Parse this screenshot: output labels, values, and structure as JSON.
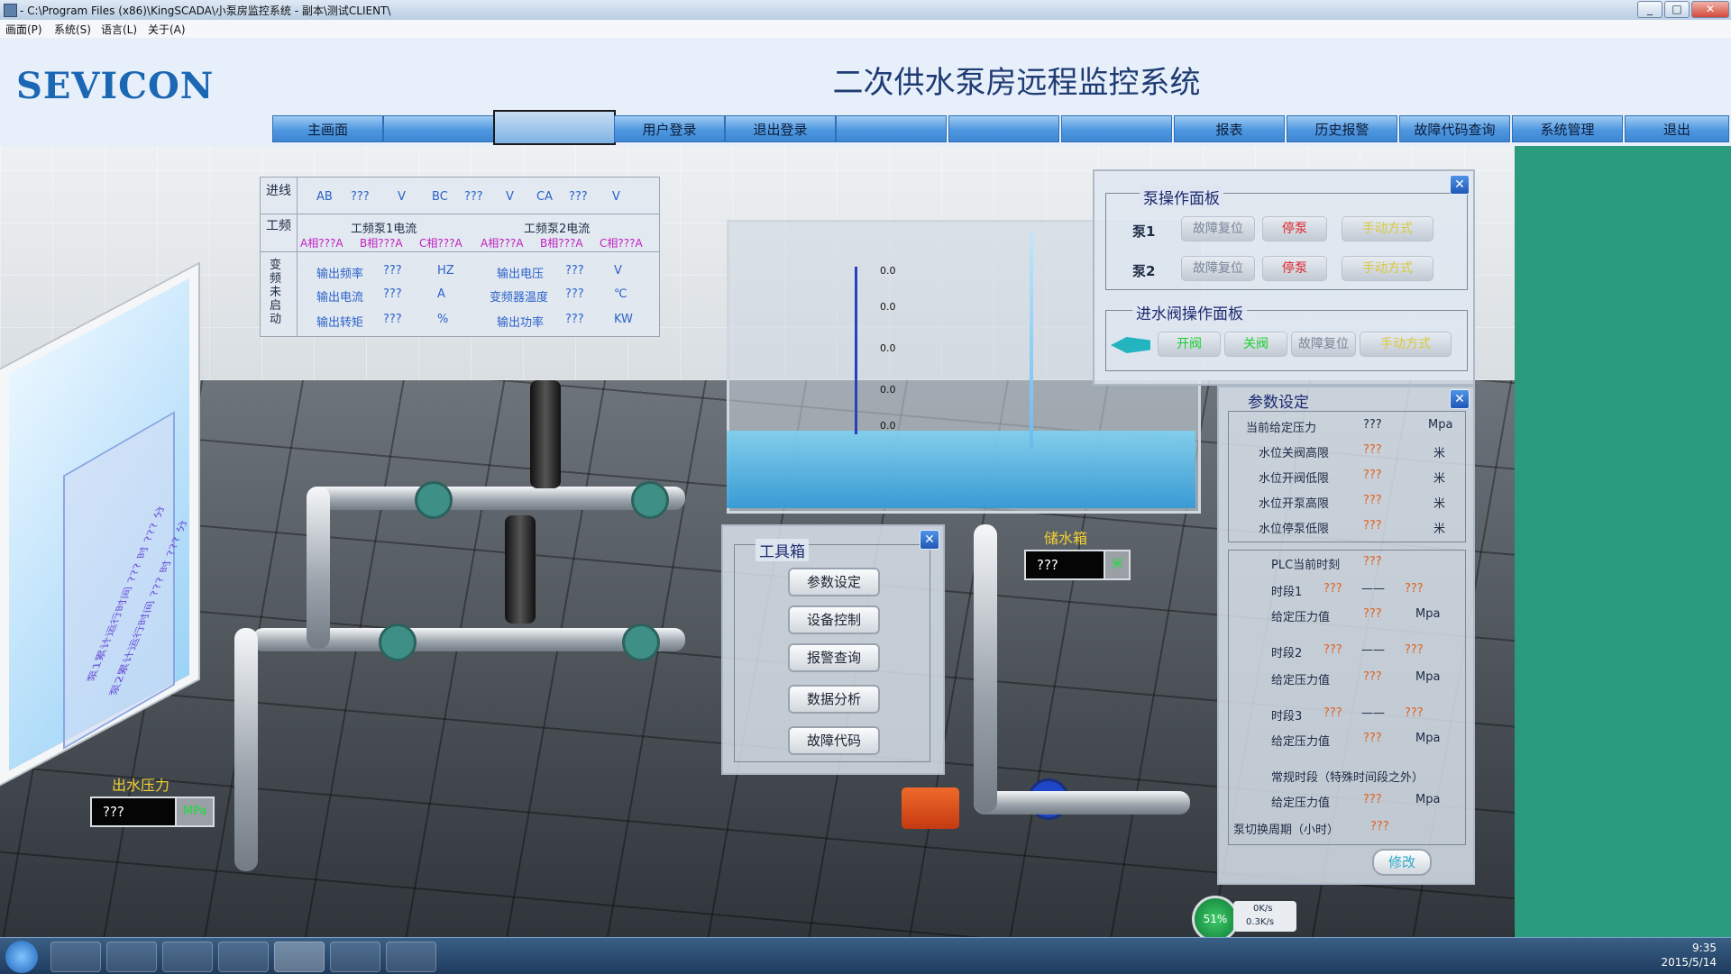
{
  "window": {
    "title": "- C:\\Program Files (x86)\\KingSCADA\\小泵房监控系统 - 副本\\测试CLIENT\\"
  },
  "menus": [
    "画面(P)",
    "系统(S)",
    "语言(L)",
    "关于(A)"
  ],
  "header": {
    "logo": "SEVICON",
    "title": "二次供水泵房远程监控系统"
  },
  "nav": [
    "主画面",
    "",
    "",
    "用户登录",
    "退出登录",
    "",
    "",
    "",
    "报表",
    "历史报警",
    "故障代码查询",
    "系统管理",
    "退出"
  ],
  "info_table": {
    "row1_label": "进线",
    "voltages": [
      {
        "pair": "AB",
        "value": "???",
        "unit": "V"
      },
      {
        "pair": "BC",
        "value": "???",
        "unit": "V"
      },
      {
        "pair": "CA",
        "value": "???",
        "unit": "V"
      }
    ],
    "row2_label": "工频",
    "pump1_current_title": "工频泵1电流",
    "pump2_current_title": "工频泵2电流",
    "phase_currents": [
      "A相???A",
      "B相???A",
      "C相???A",
      "A相???A",
      "B相???A",
      "C相???A"
    ],
    "row3_label": "变频未启动",
    "vfd": [
      [
        {
          "label": "输出频率",
          "value": "???",
          "unit": "HZ"
        },
        {
          "label": "输出电压",
          "value": "???",
          "unit": "V"
        }
      ],
      [
        {
          "label": "输出电流",
          "value": "???",
          "unit": "A"
        },
        {
          "label": "变频器温度",
          "value": "???",
          "unit": "℃"
        }
      ],
      [
        {
          "label": "输出转矩",
          "value": "???",
          "unit": "%"
        },
        {
          "label": "输出功率",
          "value": "???",
          "unit": "KW"
        }
      ]
    ]
  },
  "pump_panel": {
    "title": "泵操作面板",
    "pumps": [
      {
        "name": "泵1",
        "reset": "故障复位",
        "stop": "停泵",
        "mode": "手动方式"
      },
      {
        "name": "泵2",
        "reset": "故障复位",
        "stop": "停泵",
        "mode": "手动方式"
      }
    ],
    "valve_title": "进水阀操作面板",
    "valve_buttons": {
      "open": "开阀",
      "close": "关阀",
      "reset": "故障复位",
      "mode": "手动方式"
    }
  },
  "param_panel": {
    "title": "参数设定",
    "current_pressure": {
      "label": "当前给定压力",
      "value": "???",
      "unit": "Mpa"
    },
    "levels": [
      {
        "label": "水位关阀高限",
        "value": "???",
        "unit": "米"
      },
      {
        "label": "水位开阀低限",
        "value": "???",
        "unit": "米"
      },
      {
        "label": "水位开泵高限",
        "value": "???",
        "unit": "米"
      },
      {
        "label": "水位停泵低限",
        "value": "???",
        "unit": "米"
      }
    ],
    "plc_time": {
      "label": "PLC当前时刻",
      "value": "???"
    },
    "periods": [
      {
        "label": "时段1",
        "start": "???",
        "dash": "——",
        "end": "???",
        "plabel": "给定压力值",
        "pvalue": "???",
        "unit": "Mpa"
      },
      {
        "label": "时段2",
        "start": "???",
        "dash": "——",
        "end": "???",
        "plabel": "给定压力值",
        "pvalue": "???",
        "unit": "Mpa"
      },
      {
        "label": "时段3",
        "start": "???",
        "dash": "——",
        "end": "???",
        "plabel": "给定压力值",
        "pvalue": "???",
        "unit": "Mpa"
      }
    ],
    "normal": {
      "label": "常规时段（特殊时间段之外）",
      "plabel": "给定压力值",
      "pvalue": "???",
      "unit": "Mpa"
    },
    "switch_cycle": {
      "label": "泵切换周期（小时）",
      "value": "???"
    },
    "modify_button": "修改"
  },
  "toolbox": {
    "title": "工具箱",
    "buttons": [
      "参数设定",
      "设备控制",
      "报警查询",
      "数据分析",
      "故障代码"
    ]
  },
  "tank": {
    "label": "储水箱",
    "level_value": "???",
    "level_unit": "米",
    "scale": [
      "0.0",
      "0.0",
      "0.0",
      "0.0",
      "0.0"
    ]
  },
  "outlet_pressure": {
    "label": "出水压力",
    "value": "???",
    "unit": "MPa"
  },
  "wall_text": [
    "泵1累计运行时间",
    "???",
    "时",
    "???",
    "分",
    "泵2累计运行时间",
    "???",
    "时",
    "???",
    "分"
  ],
  "net_widget": {
    "percent": "51%",
    "up": "0K/s",
    "down": "0.3K/s"
  },
  "clock": {
    "time": "9:35",
    "date": "2015/5/14"
  },
  "colors": {
    "nav_blue": "#4f97e0",
    "panel_close": "#1f57b6",
    "green_side": "#2a9b7d",
    "value_orange": "#e2611e",
    "stop_red": "#e0202a"
  }
}
